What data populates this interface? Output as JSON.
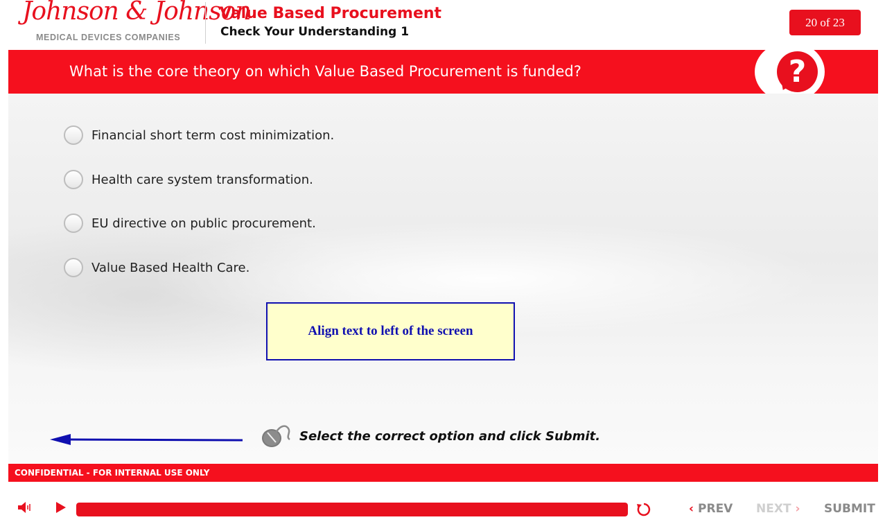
{
  "header": {
    "logo_text": "Johnson & Johnson",
    "logo_sub": "MEDICAL DEVICES COMPANIES",
    "course_title": "Value Based Procurement",
    "course_subtitle": "Check Your Understanding 1",
    "page_counter": "20 of 23"
  },
  "question": {
    "text": "What is the core theory on which Value Based Procurement is funded?",
    "help_icon": "?"
  },
  "options": [
    {
      "label": "Financial short term cost minimization.",
      "selected": false
    },
    {
      "label": "Health care system transformation.",
      "selected": false
    },
    {
      "label": "EU directive on public procurement.",
      "selected": false
    },
    {
      "label": "Value Based Health Care.",
      "selected": false
    }
  ],
  "note": {
    "text": "Align text to left of the screen"
  },
  "instruction": {
    "text": "Select the correct option and click Submit."
  },
  "footer": {
    "confidential": "CONFIDENTIAL - FOR INTERNAL USE ONLY"
  },
  "player": {
    "progress": 1.0,
    "prev_label": "PREV",
    "next_label": "NEXT",
    "submit_label": "SUBMIT",
    "next_enabled": false
  },
  "colors": {
    "brand_red": "#e8101e",
    "note_blue": "#1010b0",
    "note_bg": "#ffffcc"
  }
}
